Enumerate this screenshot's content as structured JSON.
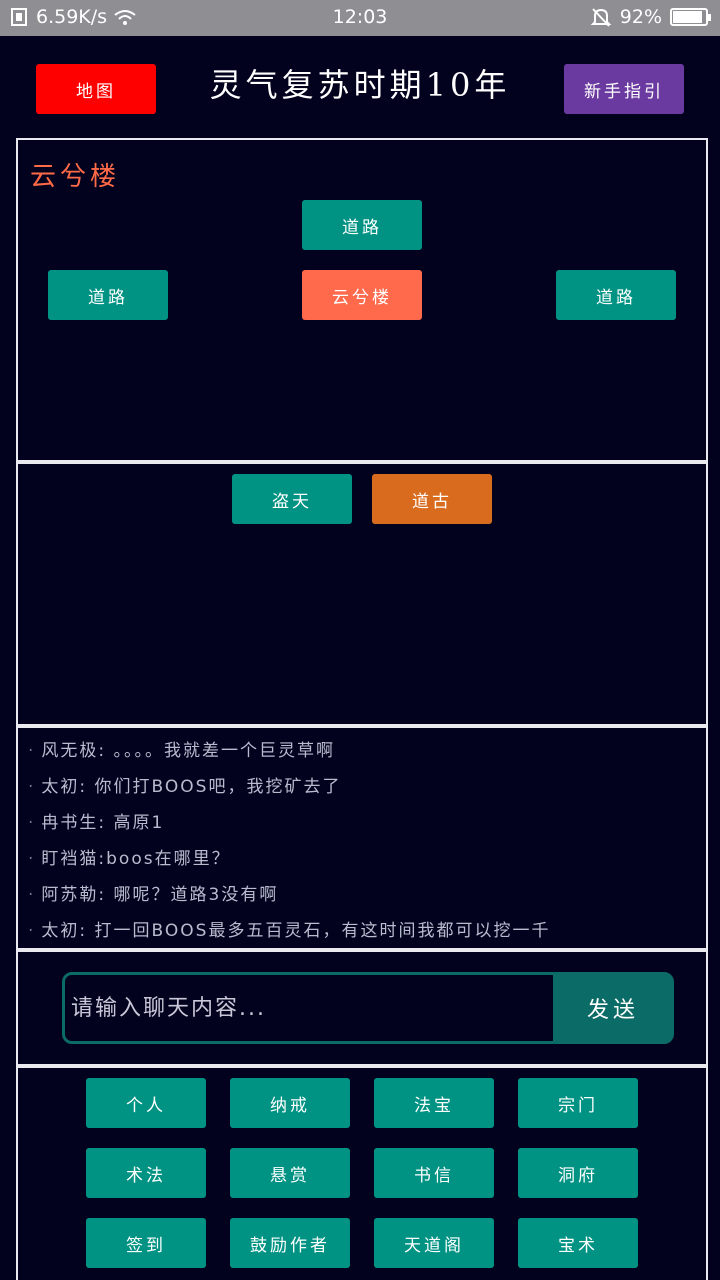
{
  "status": {
    "net_speed": "6.59K/s",
    "time": "12:03",
    "battery": "92%",
    "battery_level": 0.92
  },
  "header": {
    "title": "灵气复苏时期10年",
    "map_label": "地图",
    "guide_label": "新手指引"
  },
  "location": {
    "name": "云兮楼",
    "north": "道路",
    "west": "道路",
    "center": "云兮楼",
    "east": "道路"
  },
  "npcs": [
    "盗天",
    "道古"
  ],
  "chat": {
    "messages": [
      {
        "user": "风无极",
        "text": "。。。。我就差一个巨灵草啊"
      },
      {
        "user": "太初",
        "text": "你们打BOOS吧，我挖矿去了"
      },
      {
        "user": "冉书生",
        "text": "高原1"
      },
      {
        "user": "盯裆猫",
        "text": "boos在哪里？"
      },
      {
        "user": "阿苏勒",
        "text": "哪呢？道路3没有啊"
      },
      {
        "user": "太初",
        "text": "打一回BOOS最多五百灵石，有这时间我都可以挖一千"
      }
    ],
    "placeholder": "请输入聊天内容...",
    "send_label": "发送"
  },
  "menu": [
    [
      "个人",
      "纳戒",
      "法宝",
      "宗门"
    ],
    [
      "术法",
      "悬赏",
      "书信",
      "洞府"
    ],
    [
      "签到",
      "鼓励作者",
      "天道阁",
      "宝术"
    ]
  ],
  "colors": {
    "background": "#02021e",
    "teal": "#009384",
    "map_button": "#ff0000",
    "guide_button": "#6b3aa0",
    "current_location": "#ff6a4d",
    "npc_highlight": "#d96b1e",
    "location_title": "#ff6a47"
  }
}
